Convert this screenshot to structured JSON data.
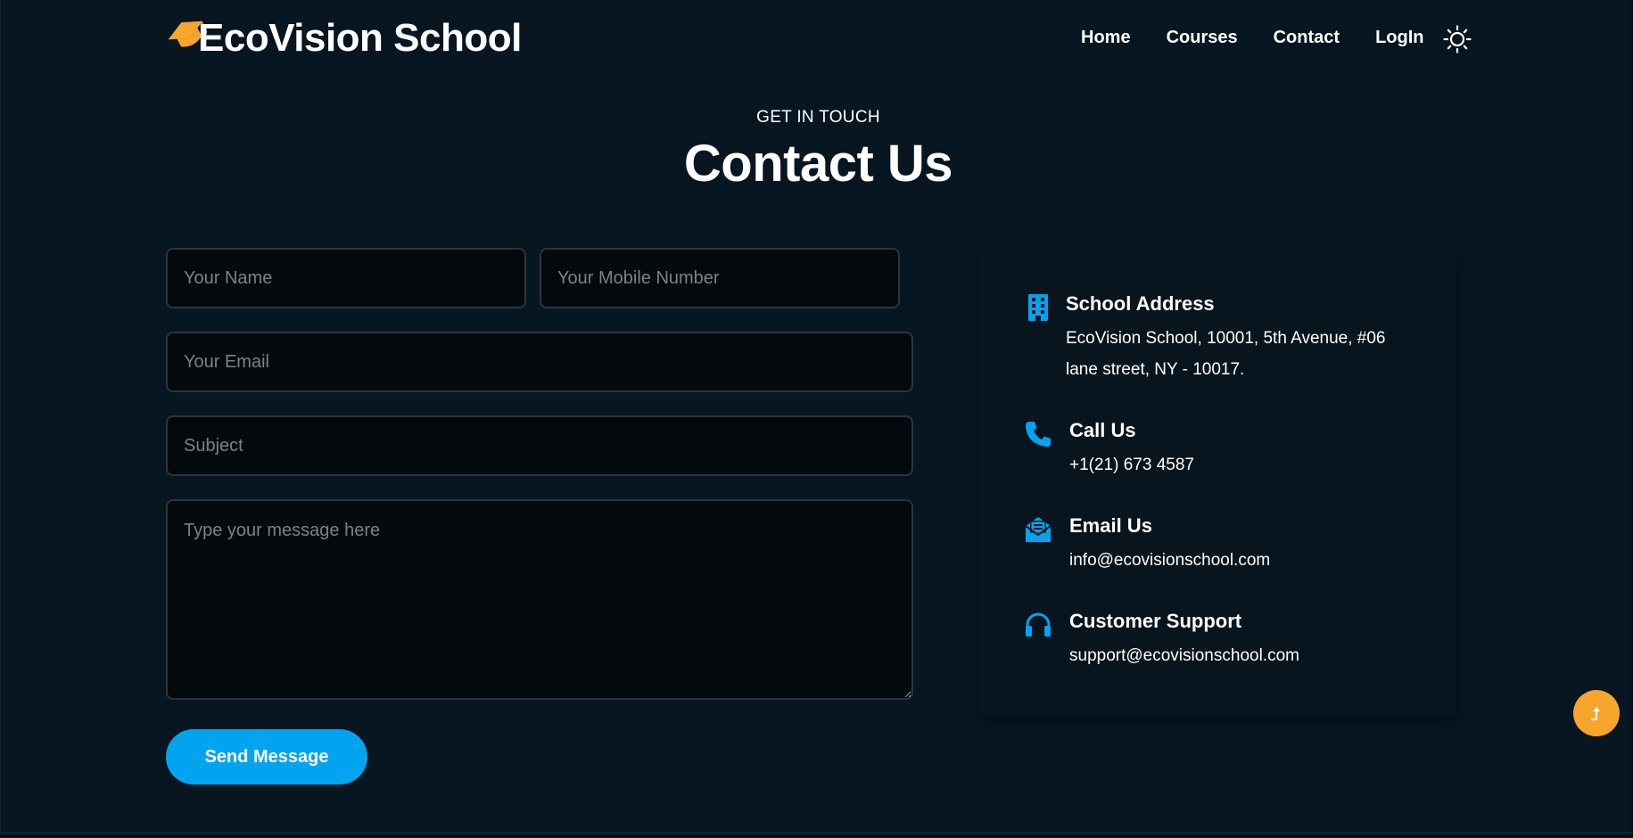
{
  "brand": {
    "name": "EcoVision School",
    "icon": "graduation-cap-icon",
    "icon_color": "#f7a52b"
  },
  "nav": {
    "items": [
      "Home",
      "Courses",
      "Contact",
      "LogIn"
    ],
    "theme_icon": "sun-icon"
  },
  "hero": {
    "eyebrow": "GET IN TOUCH",
    "title": "Contact Us"
  },
  "form": {
    "name_placeholder": "Your Name",
    "mobile_placeholder": "Your Mobile Number",
    "email_placeholder": "Your Email",
    "subject_placeholder": "Subject",
    "message_placeholder": "Type your message here",
    "submit_label": "Send Message",
    "submit_color": "#03a4ef"
  },
  "info": {
    "accent": "#03a4ef",
    "address": {
      "icon": "building-icon",
      "title": "School Address",
      "lines": [
        "EcoVision School, 10001, 5th Avenue, #06",
        "lane street, NY - 10017."
      ]
    },
    "call": {
      "icon": "phone-icon",
      "title": "Call Us",
      "value": "+1(21) 673 4587"
    },
    "email": {
      "icon": "envelope-open-icon",
      "title": "Email Us",
      "value": "info@ecovisionschool.com"
    },
    "support": {
      "icon": "headset-icon",
      "title": "Customer Support",
      "value": "support@ecovisionschool.com"
    }
  },
  "scroll_top": {
    "icon": "arrow-up-icon",
    "color": "#f7a52b"
  }
}
